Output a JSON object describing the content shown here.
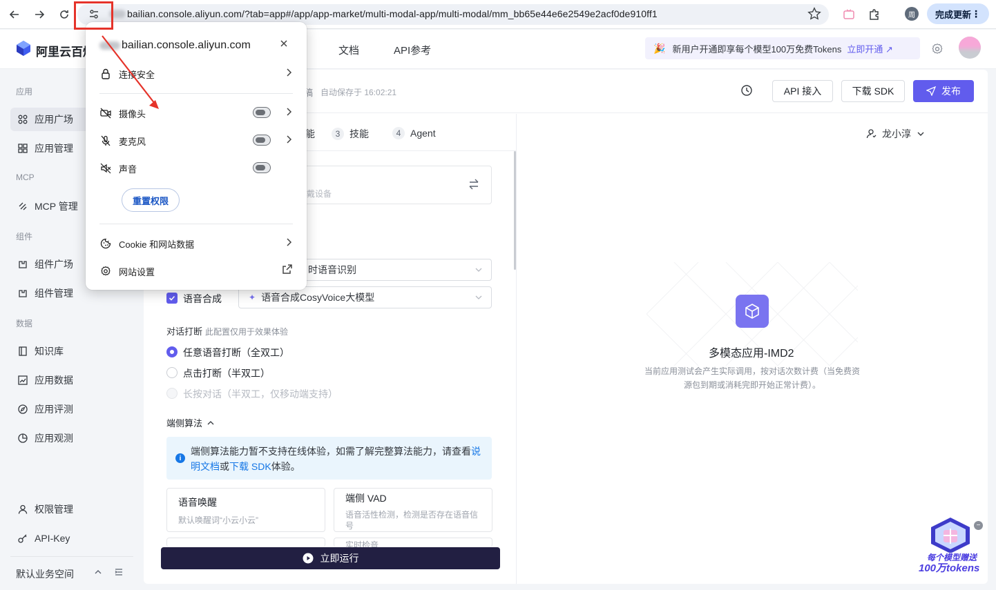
{
  "browser": {
    "url": "bailian.console.aliyun.com/?tab=app#/app/app-market/multi-modal-app/multi-modal/mm_bb65e44e6e2549e2acf0de910ff1",
    "profile_initial": "周",
    "update_label": "完成更新"
  },
  "header": {
    "logo_text": "阿里云百炼",
    "nav": [
      "文档",
      "API参考"
    ],
    "promo_text": "新用户开通即享每个模型100万免费Tokens",
    "promo_link": "立即开通 ↗"
  },
  "sidebar": {
    "sections": [
      "应用",
      "MCP",
      "组件",
      "数据"
    ],
    "items": [
      {
        "label": "应用广场",
        "icon": "grid-icon"
      },
      {
        "label": "应用管理",
        "icon": "grid-icon"
      },
      {
        "label": "MCP 管理",
        "icon": "mcp-icon"
      },
      {
        "label": "组件广场",
        "icon": "component-icon"
      },
      {
        "label": "组件管理",
        "icon": "component-icon"
      },
      {
        "label": "知识库",
        "icon": "book-icon"
      },
      {
        "label": "应用数据",
        "icon": "chart-icon"
      },
      {
        "label": "应用评测",
        "icon": "compass-icon"
      },
      {
        "label": "应用观测",
        "icon": "observe-icon"
      },
      {
        "label": "权限管理",
        "icon": "user-icon"
      },
      {
        "label": "API-Key",
        "icon": "key-icon"
      }
    ],
    "workspace": "默认业务空间"
  },
  "toolbar": {
    "saved_title": "稿",
    "saved_text": "自动保存于 16:02:21",
    "api_access": "API 接入",
    "download_sdk": "下载 SDK",
    "publish": "发布"
  },
  "steps": [
    {
      "num": "3",
      "label": "技能"
    },
    {
      "num": "4",
      "label": "Agent"
    }
  ],
  "config": {
    "step_fragment": "能",
    "device_hint": "戴设备",
    "asr_select": "时语音识别",
    "tts_label": "语音合成",
    "tts_select": "语音合成CosyVoice大模型",
    "interrupt_label": "对话打断",
    "interrupt_sub": "此配置仅用于效果体验",
    "radio_options": [
      {
        "label": "任意语音打断（全双工）",
        "state": "selected"
      },
      {
        "label": "点击打断（半双工）",
        "state": "unselected"
      },
      {
        "label": "长按对话（半双工，仅移动端支持）",
        "state": "disabled"
      }
    ],
    "edge_algo_label": "端侧算法",
    "info_text_1": "端侧算法能力暂不支持在线体验，如需了解完整算法能力，请查看",
    "info_link_1": "说明文档",
    "info_text_2": "或",
    "info_link_2": "下载 SDK",
    "info_text_3": "体验。",
    "cards": [
      {
        "title": "语音唤醒",
        "desc": "默认唤醒词“小云小云”"
      },
      {
        "title": "端侧 VAD",
        "desc": "语音活性检测，检测是否存在语音信号"
      }
    ],
    "card_partial": "实时检音",
    "run_button": "立即运行"
  },
  "preview": {
    "user": "龙小淳",
    "app_title": "多模态应用-IMD2",
    "app_desc": "当前应用测试会产生实际调用，按对话次数计费（当免费资源包到期或消耗完即开始正常计费）。"
  },
  "gift": {
    "line1": "每个模型赠送",
    "line2": "100万tokens"
  },
  "popup": {
    "domain": "bailian.console.aliyun.com",
    "connection": "连接安全",
    "camera": "摄像头",
    "microphone": "麦克风",
    "sound": "声音",
    "reset": "重置权限",
    "cookies": "Cookie 和网站数据",
    "site_settings": "网站设置"
  }
}
